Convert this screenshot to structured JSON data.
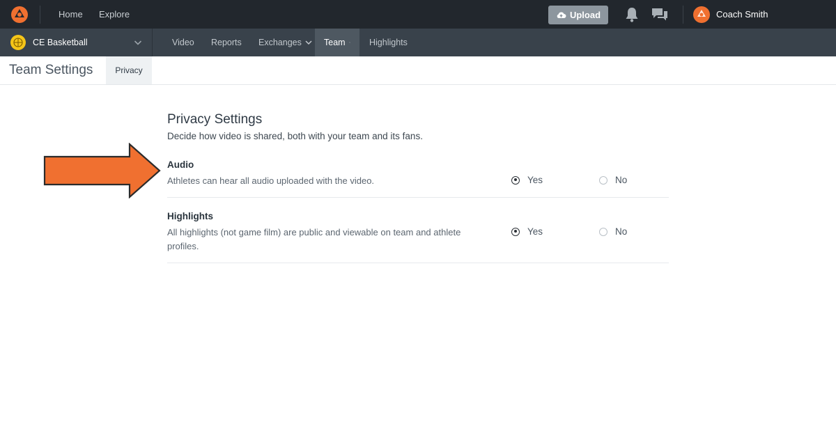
{
  "topbar": {
    "nav": [
      {
        "label": "Home"
      },
      {
        "label": "Explore"
      }
    ],
    "upload_label": "Upload",
    "user_name": "Coach Smith"
  },
  "subnav": {
    "team_name": "CE Basketball",
    "items": [
      {
        "label": "Video"
      },
      {
        "label": "Reports"
      },
      {
        "label": "Exchanges"
      },
      {
        "label": "Team"
      },
      {
        "label": "Highlights"
      }
    ],
    "active": "Team"
  },
  "page": {
    "title": "Team Settings",
    "tab": "Privacy"
  },
  "privacy": {
    "title": "Privacy Settings",
    "subtitle": "Decide how video is shared, both with your team and its fans.",
    "settings": [
      {
        "title": "Audio",
        "description": "Athletes can hear all audio uploaded with the video.",
        "yes_label": "Yes",
        "no_label": "No",
        "selected": "Yes"
      },
      {
        "title": "Highlights",
        "description": "All highlights (not game film) are public and viewable on team and athlete profiles.",
        "yes_label": "Yes",
        "no_label": "No",
        "selected": "Yes"
      }
    ]
  },
  "colors": {
    "accent_orange": "#f07030",
    "topbar_bg": "#22272d",
    "subbar_bg": "#39424b",
    "team_ball": "#f5c518"
  },
  "icons": {
    "logo": "hudl-logo-icon",
    "upload": "cloud-upload-icon",
    "notifications": "bell-icon",
    "messages": "chat-bubbles-icon",
    "team": "basketball-icon",
    "annotation": "orange-arrow-icon"
  }
}
